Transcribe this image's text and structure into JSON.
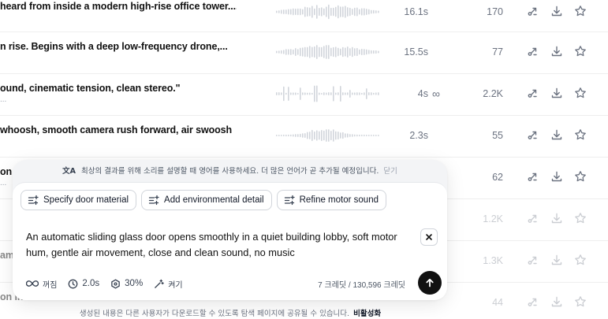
{
  "rows": [
    {
      "title": "heard from inside a modern high-rise office tower....",
      "subtitle": "",
      "duration": "16.1s",
      "loop": false,
      "count": "170",
      "faded": false
    },
    {
      "title": "n rise. Begins with a deep low-frequency drone,...",
      "subtitle": "",
      "duration": "15.5s",
      "loop": false,
      "count": "77",
      "faded": false
    },
    {
      "title": "ound, cinematic tension, clean stereo.\"",
      "subtitle": "...",
      "duration": "4s",
      "loop": true,
      "count": "2.2K",
      "faded": false
    },
    {
      "title": "whoosh, smooth camera rush forward, air swoosh",
      "subtitle": "",
      "duration": "2.3s",
      "loop": false,
      "count": "55",
      "faded": false
    },
    {
      "title": "on p",
      "subtitle": "...",
      "duration": "",
      "loop": false,
      "count": "62",
      "faded": false
    },
    {
      "title": "",
      "subtitle": "",
      "duration": "",
      "loop": false,
      "count": "1.2K",
      "faded": true
    },
    {
      "title": "am",
      "subtitle": "",
      "duration": "",
      "loop": false,
      "count": "1.3K",
      "faded": true
    },
    {
      "title": "on in",
      "subtitle": "",
      "duration": "",
      "loop": false,
      "count": "44",
      "faded": true
    }
  ],
  "row_actions": {
    "remix_icon": "remix-icon",
    "download_icon": "download-icon",
    "favorite_icon": "star-icon"
  },
  "notice": {
    "icon": "translate-icon",
    "text": "최상의 결과를 위해 소리를 설명할 때 영어를 사용하세요. 더 많은 언어가 곧 추가될 예정입니다.",
    "close": "닫기"
  },
  "suggestions": [
    {
      "label": "Specify door material"
    },
    {
      "label": "Add environmental detail"
    },
    {
      "label": "Refine motor sound"
    }
  ],
  "prompt": {
    "text": "An automatic sliding glass door opens smoothly in a quiet building lobby, soft motor hum, gentle air movement, close and clean sound, no music"
  },
  "controls": {
    "loop_label": "꺼짐",
    "duration_label": "2.0s",
    "influence_label": "30%",
    "enhance_label": "켜기"
  },
  "credits": {
    "used": "7",
    "unit": "크레딧",
    "separator": "/",
    "total": "130,596"
  },
  "footer": {
    "text": "생성된 내용은 다른 사용자가 다운로드할 수 있도록 탐색 페이지에 공유될 수 있습니다.",
    "link": "비활성화"
  },
  "colors": {
    "panel_bg": "#f3f4f6",
    "send_button": "#111111",
    "text_muted": "#6b7280"
  }
}
